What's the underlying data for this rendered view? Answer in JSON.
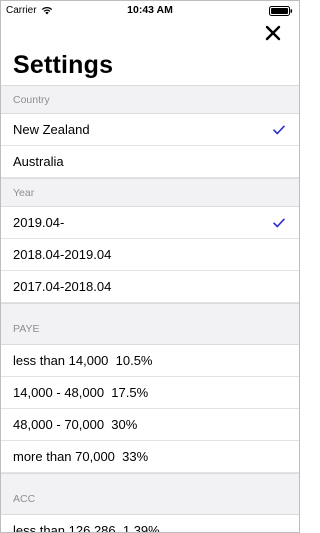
{
  "status_bar": {
    "carrier": "Carrier",
    "time": "10:43 AM"
  },
  "nav": {
    "close_icon": "close-icon"
  },
  "page": {
    "title": "Settings"
  },
  "sections": [
    {
      "header": "Country",
      "rows": [
        {
          "label": "New Zealand",
          "selected": true
        },
        {
          "label": "Australia",
          "selected": false
        }
      ]
    },
    {
      "header": "Year",
      "rows": [
        {
          "label": "2019.04-",
          "selected": true
        },
        {
          "label": "2018.04-2019.04",
          "selected": false
        },
        {
          "label": "2017.04-2018.04",
          "selected": false
        }
      ]
    },
    {
      "header": "PAYE",
      "rows": [
        {
          "label": "less than 14,000  10.5%"
        },
        {
          "label": "14,000 - 48,000  17.5%"
        },
        {
          "label": "48,000 - 70,000  30%"
        },
        {
          "label": "more than 70,000  33%"
        }
      ]
    },
    {
      "header": "ACC",
      "rows": [
        {
          "label": "less than 126,286  1.39%"
        }
      ]
    }
  ],
  "colors": {
    "checkmark": "#2b2bd6",
    "section_bg": "#f2f2f4",
    "section_text": "#8e8e93"
  }
}
